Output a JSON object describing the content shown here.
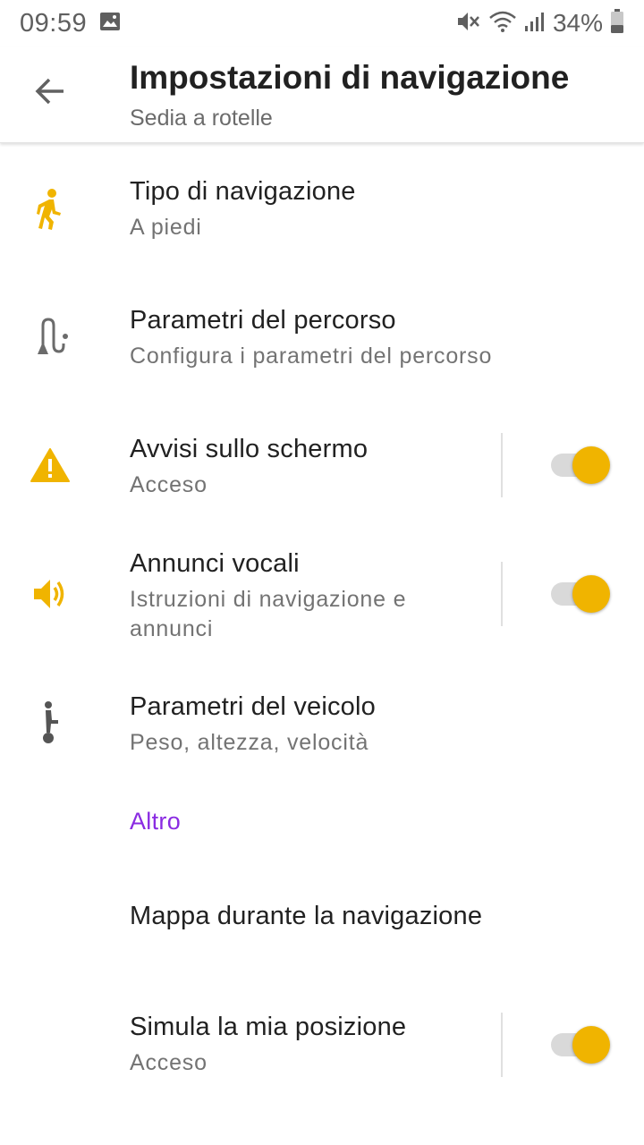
{
  "status_bar": {
    "time": "09:59",
    "battery": "34%",
    "icons": [
      "image-icon",
      "mute-icon",
      "wifi-icon",
      "signal-icon",
      "battery-icon"
    ]
  },
  "toolbar": {
    "title": "Impostazioni di navigazione",
    "subtitle": "Sedia a rotelle",
    "back_icon": "arrow-back-icon"
  },
  "items": [
    {
      "title": "Tipo di navigazione",
      "subtitle": "A piedi",
      "icon": "walking-icon",
      "icon_color": "#f0b400"
    },
    {
      "title": "Parametri del percorso",
      "subtitle": "Configura i parametri del percorso",
      "icon": "route-icon",
      "icon_color": "#6b6b6b"
    },
    {
      "title": "Avvisi sullo schermo",
      "subtitle": "Acceso",
      "icon": "warning-icon",
      "icon_color": "#f0b400",
      "toggle": true
    },
    {
      "title": "Annunci vocali",
      "subtitle": "Istruzioni di navigazione e annunci",
      "icon": "speaker-icon",
      "icon_color": "#f0b400",
      "toggle": true
    },
    {
      "title": "Parametri del veicolo",
      "subtitle": "Peso, altezza, velocità",
      "icon": "vehicle-icon",
      "icon_color": "#6b6b6b"
    }
  ],
  "section": {
    "label": "Altro",
    "color": "#8a2be2"
  },
  "other_items": [
    {
      "title": "Mappa durante la navigazione"
    },
    {
      "title": "Simula la mia posizione",
      "subtitle": "Acceso",
      "toggle": true
    }
  ],
  "colors": {
    "accent": "#f0b400",
    "section": "#8a2be2",
    "track": "#d9d9d9"
  }
}
